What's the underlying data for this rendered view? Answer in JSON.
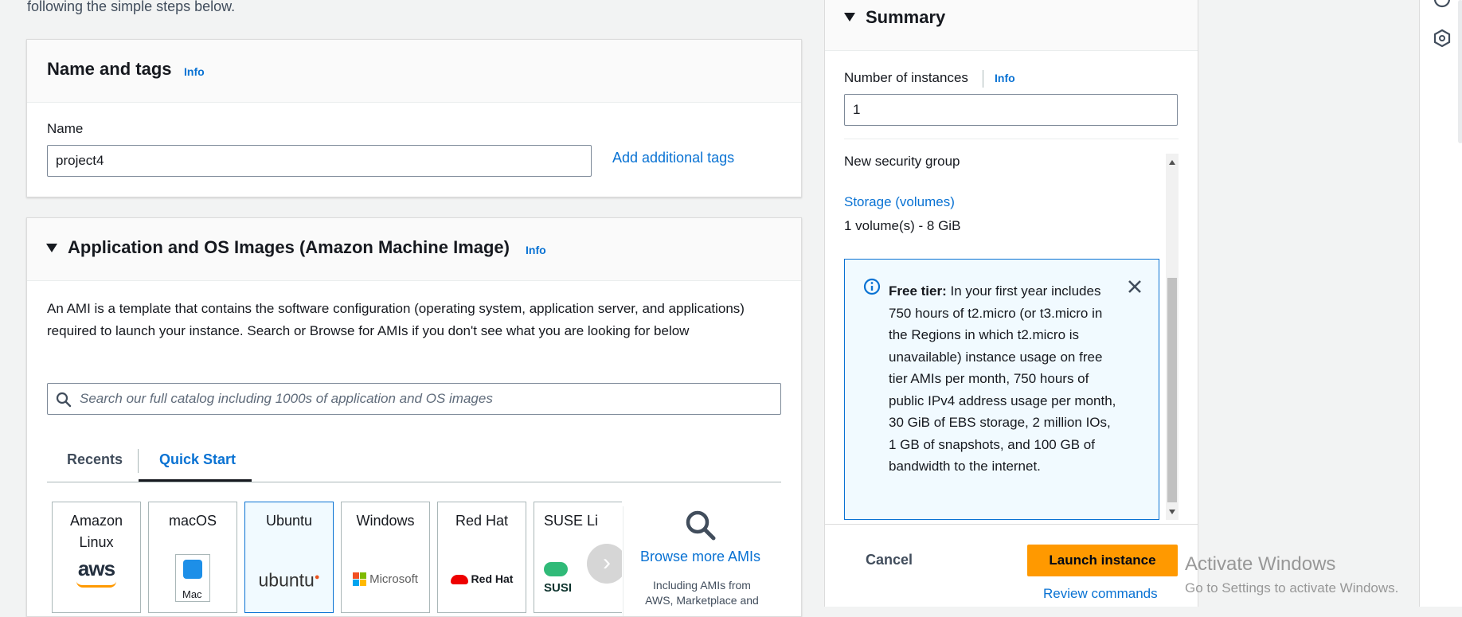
{
  "intro_text": "following the simple steps below.",
  "name_tags": {
    "title": "Name and tags",
    "info": "Info",
    "name_label": "Name",
    "name_value": "project4",
    "add_tags": "Add additional tags"
  },
  "ami": {
    "title": "Application and OS Images (Amazon Machine Image)",
    "info": "Info",
    "description": "An AMI is a template that contains the software configuration (operating system, application server, and applications) required to launch your instance. Search or Browse for AMIs if you don't see what you are looking for below",
    "search_placeholder": "Search our full catalog including 1000s of application and OS images",
    "tabs": [
      "Recents",
      "Quick Start"
    ],
    "tiles": [
      {
        "label": "Amazon\nLinux",
        "logo": "aws"
      },
      {
        "label": "macOS",
        "logo": "Mac"
      },
      {
        "label": "Ubuntu",
        "logo": "ubuntu"
      },
      {
        "label": "Windows",
        "logo": "Microsoft"
      },
      {
        "label": "Red Hat",
        "logo": "Red Hat"
      },
      {
        "label": "SUSE Li",
        "logo": "SUSI"
      }
    ],
    "browse_more": "Browse more AMIs",
    "browse_sub": "Including AMIs from AWS, Marketplace and"
  },
  "summary": {
    "title": "Summary",
    "instances_label": "Number of instances",
    "info": "Info",
    "instances_value": "1",
    "security_group": "New security group",
    "storage_link": "Storage (volumes)",
    "storage_value": "1 volume(s) - 8 GiB",
    "free_tier_bold": "Free tier:",
    "free_tier_text": " In your first year includes 750 hours of t2.micro (or t3.micro in the Regions in which t2.micro is unavailable) instance usage on free tier AMIs per month, 750 hours of public IPv4 address usage per month, 30 GiB of EBS storage, 2 million IOs, 1 GB of snapshots, and 100 GB of bandwidth to the internet.",
    "cancel": "Cancel",
    "launch": "Launch instance",
    "review": "Review commands"
  },
  "watermark": {
    "title": "Activate Windows",
    "subtitle": "Go to Settings to activate Windows."
  },
  "colors": {
    "link": "#0972d3",
    "primary_button": "#ff9900",
    "info_border": "#0972d3",
    "info_bg": "#f1faff"
  }
}
